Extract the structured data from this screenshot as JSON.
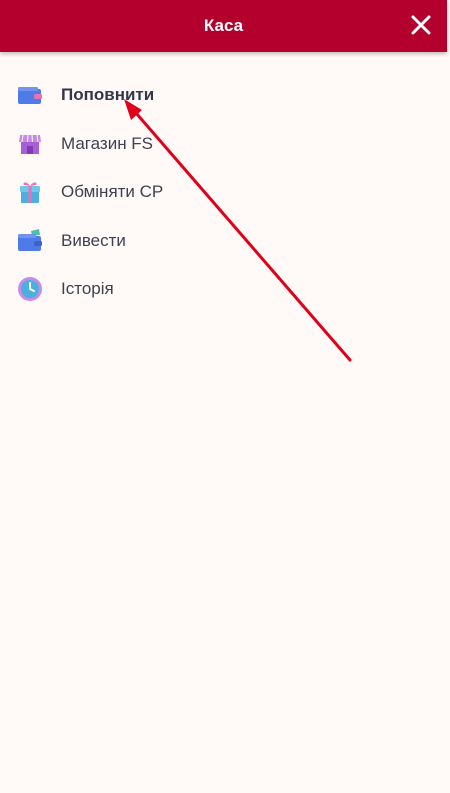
{
  "header": {
    "title": "Каса",
    "close_icon": "close-icon"
  },
  "menu": {
    "items": [
      {
        "label": "Поповнити",
        "icon": "wallet-icon",
        "active": true
      },
      {
        "label": "Магазин FS",
        "icon": "shop-icon",
        "active": false
      },
      {
        "label": "Обміняти CP",
        "icon": "gift-icon",
        "active": false
      },
      {
        "label": "Вивести",
        "icon": "wallet-withdraw-icon",
        "active": false
      },
      {
        "label": "Історія",
        "icon": "clock-icon",
        "active": false
      }
    ]
  },
  "colors": {
    "header_bg": "#b3002d",
    "page_bg": "#fffaf7",
    "text": "#3f4150",
    "annotation_arrow": "#e0001a"
  }
}
